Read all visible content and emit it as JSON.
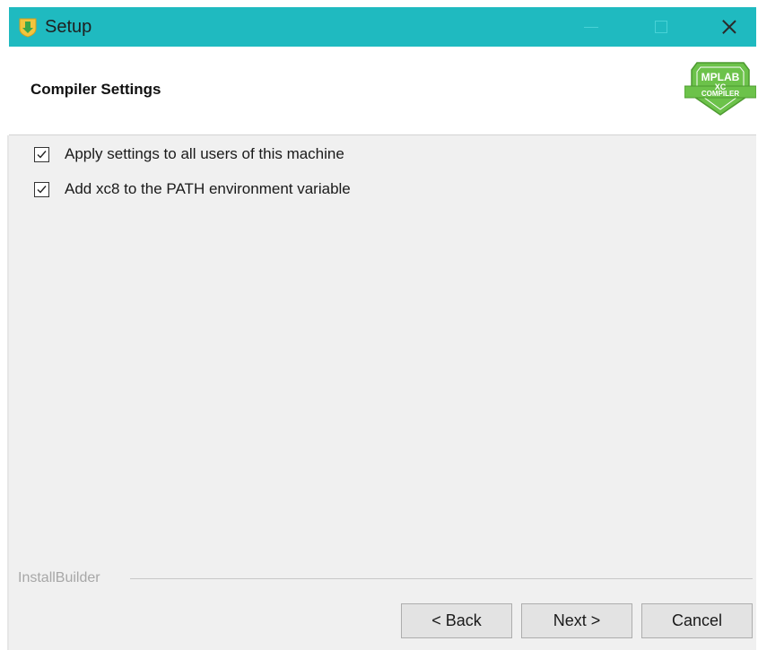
{
  "window": {
    "title": "Setup",
    "app_icon": "installer-shield-icon",
    "controls": {
      "minimize_icon": "minimize-icon",
      "maximize_icon": "maximize-icon",
      "close_icon": "close-icon"
    }
  },
  "header": {
    "title": "Compiler Settings",
    "logo": {
      "icon": "mplab-xc-compiler-logo",
      "line1": "MPLAB",
      "line2": "XC",
      "line3": "COMPILER"
    }
  },
  "options": [
    {
      "label": "Apply settings to all users of this machine",
      "checked": true
    },
    {
      "label": "Add xc8 to the PATH environment variable",
      "checked": true
    }
  ],
  "footer": {
    "brand": "InstallBuilder",
    "buttons": {
      "back": "< Back",
      "next": "Next >",
      "cancel": "Cancel"
    }
  },
  "colors": {
    "titlebar": "#1fbac0",
    "content_bg": "#f0f0f0",
    "logo_green": "#6cc24a"
  }
}
